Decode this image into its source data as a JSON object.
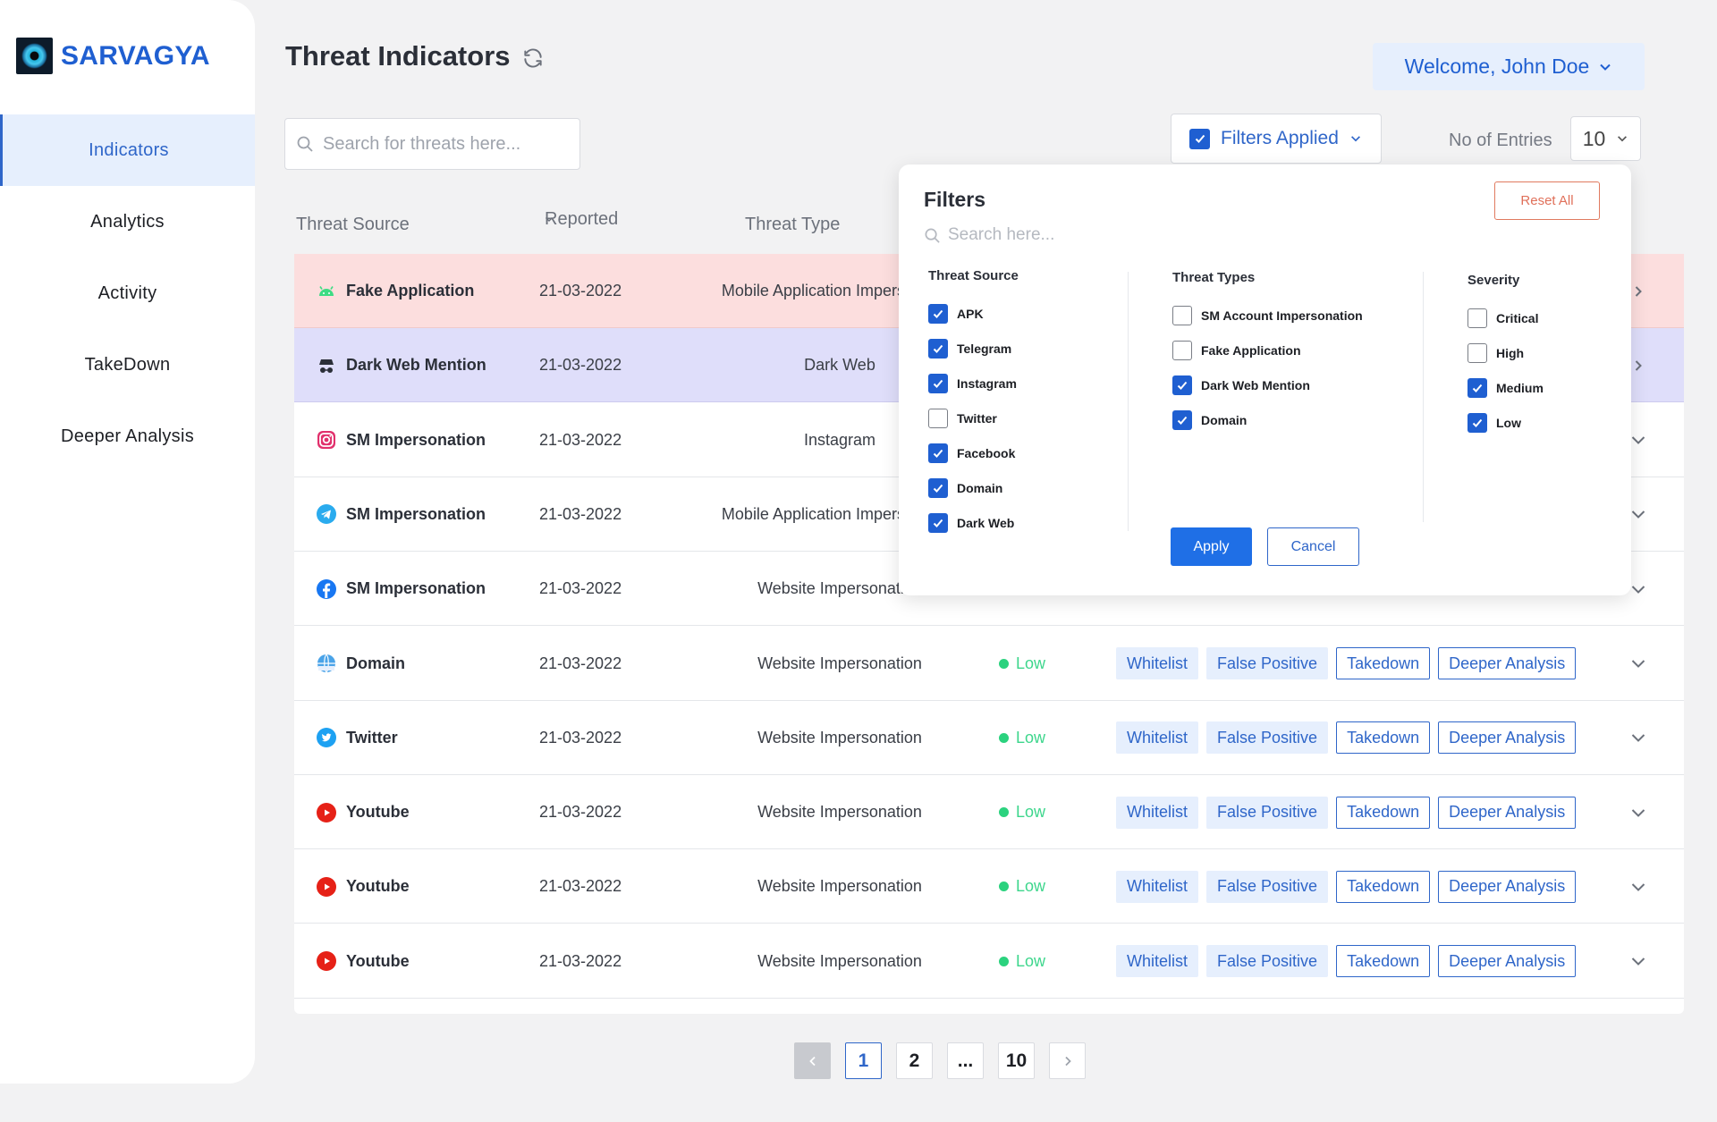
{
  "app": {
    "name": "SARVAGYA"
  },
  "sidebar": {
    "items": [
      {
        "label": "Indicators",
        "active": true
      },
      {
        "label": "Analytics",
        "active": false
      },
      {
        "label": "Activity",
        "active": false
      },
      {
        "label": "TakeDown",
        "active": false
      },
      {
        "label": "Deeper Analysis",
        "active": false
      }
    ]
  },
  "header": {
    "title": "Threat Indicators",
    "welcome": "Welcome, John Doe"
  },
  "search": {
    "placeholder": "Search for threats here..."
  },
  "filters_button": {
    "label": "Filters Applied"
  },
  "entries": {
    "label": "No of Entries",
    "value": "10"
  },
  "table": {
    "columns": [
      "Threat Source",
      "Reported",
      "Threat Type"
    ],
    "action_labels": {
      "whitelist": "Whitelist",
      "false_positive": "False Positive",
      "takedown": "Takedown",
      "deeper": "Deeper Analysis"
    },
    "rows": [
      {
        "source": "Fake Application",
        "icon": "android-icon",
        "date": "21-03-2022",
        "type": "Mobile Application Impersonation",
        "severity": "",
        "highlight": "pink"
      },
      {
        "source": "Dark Web Mention",
        "icon": "spy-icon",
        "date": "21-03-2022",
        "type": "Dark Web",
        "severity": "",
        "highlight": "lav"
      },
      {
        "source": "SM Impersonation",
        "icon": "instagram-icon",
        "date": "21-03-2022",
        "type": "Instagram",
        "severity": ""
      },
      {
        "source": "SM Impersonation",
        "icon": "telegram-icon",
        "date": "21-03-2022",
        "type": "Mobile Application Impersonation",
        "severity": ""
      },
      {
        "source": "SM Impersonation",
        "icon": "facebook-icon",
        "date": "21-03-2022",
        "type": "Website Impersonation",
        "severity": ""
      },
      {
        "source": "Domain",
        "icon": "globe-icon",
        "date": "21-03-2022",
        "type": "Website Impersonation",
        "severity": "Low"
      },
      {
        "source": "Twitter",
        "icon": "twitter-icon",
        "date": "21-03-2022",
        "type": "Website Impersonation",
        "severity": "Low"
      },
      {
        "source": "Youtube",
        "icon": "youtube-icon",
        "date": "21-03-2022",
        "type": "Website Impersonation",
        "severity": "Low"
      },
      {
        "source": "Youtube",
        "icon": "youtube-icon",
        "date": "21-03-2022",
        "type": "Website Impersonation",
        "severity": "Low"
      },
      {
        "source": "Youtube",
        "icon": "youtube-icon",
        "date": "21-03-2022",
        "type": "Website Impersonation",
        "severity": "Low"
      }
    ]
  },
  "pagination": {
    "pages": [
      "1",
      "2",
      "...",
      "10"
    ],
    "current": "1"
  },
  "filters_panel": {
    "title": "Filters",
    "reset_label": "Reset All",
    "search_placeholder": "Search here...",
    "apply_label": "Apply",
    "cancel_label": "Cancel",
    "threat_source": {
      "title": "Threat Source",
      "options": [
        {
          "label": "APK",
          "checked": true
        },
        {
          "label": "Telegram",
          "checked": true
        },
        {
          "label": "Instagram",
          "checked": true
        },
        {
          "label": "Twitter",
          "checked": false
        },
        {
          "label": "Facebook",
          "checked": true
        },
        {
          "label": "Domain",
          "checked": true
        },
        {
          "label": "Dark Web",
          "checked": true
        }
      ]
    },
    "threat_types": {
      "title": "Threat Types",
      "options": [
        {
          "label": "SM Account Impersonation",
          "checked": false
        },
        {
          "label": "Fake Application",
          "checked": false
        },
        {
          "label": "Dark Web Mention",
          "checked": true
        },
        {
          "label": "Domain",
          "checked": true
        }
      ]
    },
    "severity": {
      "title": "Severity",
      "options": [
        {
          "label": "Critical",
          "checked": false
        },
        {
          "label": "High",
          "checked": false
        },
        {
          "label": "Medium",
          "checked": true
        },
        {
          "label": "Low",
          "checked": true
        }
      ]
    }
  },
  "colors": {
    "accent": "#1f5fd1",
    "low": "#3dd68c",
    "pink_row": "#fcdede",
    "lavender_row": "#dfdefa"
  }
}
